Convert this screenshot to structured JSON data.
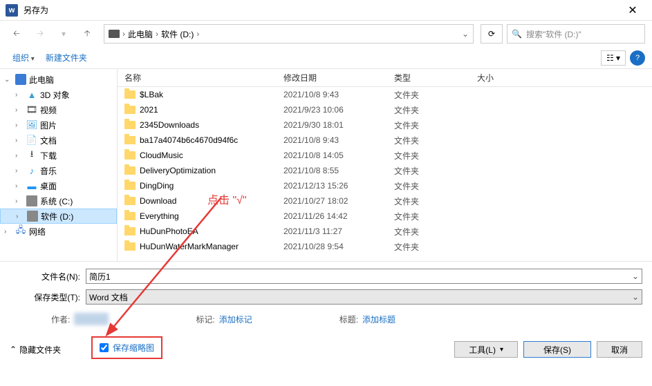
{
  "title": "另存为",
  "breadcrumb": {
    "pc": "此电脑",
    "drive": "软件 (D:)"
  },
  "search_placeholder": "搜索\"软件 (D:)\"",
  "toolbar": {
    "organize": "组织",
    "newfolder": "新建文件夹"
  },
  "sidebar": {
    "pc": "此电脑",
    "items": [
      {
        "label": "3D 对象",
        "icon": "3d"
      },
      {
        "label": "视频",
        "icon": "video"
      },
      {
        "label": "图片",
        "icon": "pic"
      },
      {
        "label": "文档",
        "icon": "doc"
      },
      {
        "label": "下载",
        "icon": "dl"
      },
      {
        "label": "音乐",
        "icon": "music"
      },
      {
        "label": "桌面",
        "icon": "desktop"
      },
      {
        "label": "系统 (C:)",
        "icon": "drive"
      },
      {
        "label": "软件 (D:)",
        "icon": "drive",
        "selected": true
      }
    ],
    "network": "网络"
  },
  "columns": {
    "name": "名称",
    "date": "修改日期",
    "type": "类型",
    "size": "大小"
  },
  "files": [
    {
      "name": "$LBak",
      "date": "2021/10/8 9:43",
      "type": "文件夹"
    },
    {
      "name": "2021",
      "date": "2021/9/23 10:06",
      "type": "文件夹"
    },
    {
      "name": "2345Downloads",
      "date": "2021/9/30 18:01",
      "type": "文件夹"
    },
    {
      "name": "ba17a4074b6c4670d94f6c",
      "date": "2021/10/8 9:43",
      "type": "文件夹"
    },
    {
      "name": "CloudMusic",
      "date": "2021/10/8 14:05",
      "type": "文件夹"
    },
    {
      "name": "DeliveryOptimization",
      "date": "2021/10/8 8:55",
      "type": "文件夹"
    },
    {
      "name": "DingDing",
      "date": "2021/12/13 15:26",
      "type": "文件夹"
    },
    {
      "name": "Download",
      "date": "2021/10/27 18:02",
      "type": "文件夹"
    },
    {
      "name": "Everything",
      "date": "2021/11/26 14:42",
      "type": "文件夹"
    },
    {
      "name": "HuDunPhotoEA",
      "date": "2021/11/3 11:27",
      "type": "文件夹"
    },
    {
      "name": "HuDunWaterMarkManager",
      "date": "2021/10/28 9:54",
      "type": "文件夹"
    }
  ],
  "filename_label": "文件名(N):",
  "filename_value": "简历1",
  "filetype_label": "保存类型(T):",
  "filetype_value": "Word 文档",
  "meta": {
    "author_label": "作者:",
    "tag_label": "标记:",
    "tag_value": "添加标记",
    "title_label": "标题:",
    "title_value": "添加标题"
  },
  "checkbox_label": "保存缩略图",
  "footer": {
    "hide": "隐藏文件夹",
    "tools": "工具(L)",
    "save": "保存(S)",
    "cancel": "取消"
  },
  "annotation": "点击 \"√\""
}
